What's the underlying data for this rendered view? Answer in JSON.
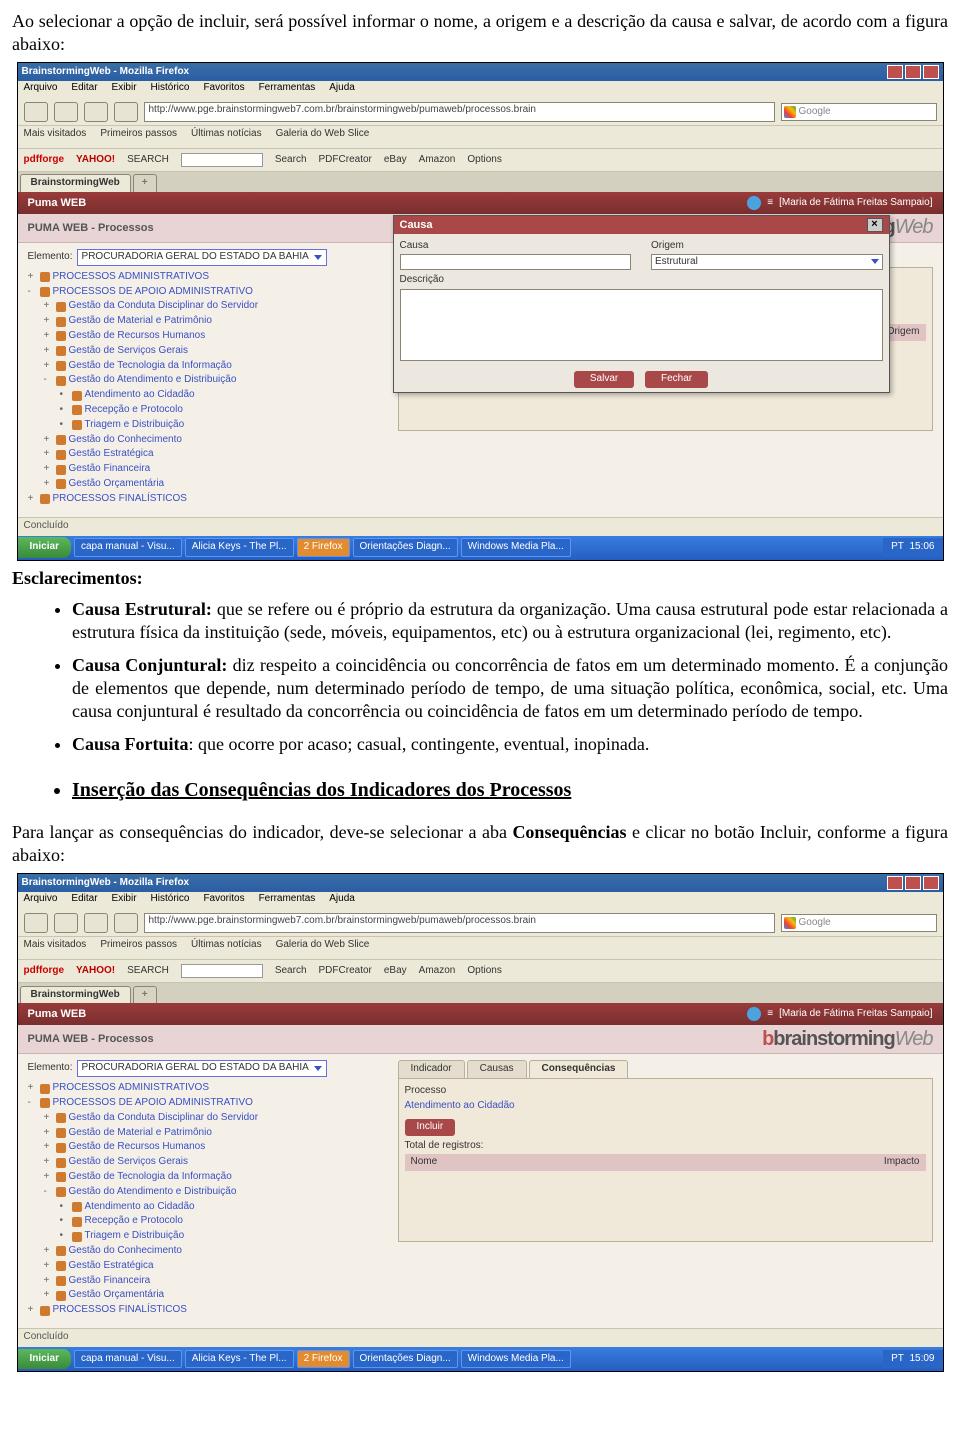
{
  "intro1": "Ao selecionar a opção de incluir, será possível informar o nome, a origem e a descrição da causa e salvar, de acordo com a figura abaixo:",
  "esclarecimentos": "Esclarecimentos:",
  "bullets": {
    "estrutural_label": "Causa Estrutural:",
    "estrutural_text": " que se refere ou é próprio da estrutura da organização. Uma causa estrutural pode estar relacionada a estrutura física da instituição (sede, móveis, equipamentos, etc) ou à estrutura organizacional (lei, regimento, etc).",
    "conjuntural_label": "Causa Conjuntural:",
    "conjuntural_text": " diz respeito a coincidência ou concorrência de fatos em um determinado momento. É a conjunção de elementos que depende, num determinado período de tempo, de uma situação política, econômica, social, etc. Uma causa conjuntural é resultado da concorrência ou coincidência de fatos em um determinado período de tempo.",
    "fortuita_label": "Causa Fortuita",
    "fortuita_text": ": que ocorre por acaso; casual, contingente, eventual, inopinada."
  },
  "section_title": "Inserção das Consequências dos Indicadores dos Processos",
  "intro2a": "Para lançar as consequências do indicador, deve-se  selecionar a aba ",
  "intro2b": "Consequências",
  "intro2c": " e clicar no botão Incluir, conforme a figura abaixo:",
  "browser": {
    "title": "BrainstormingWeb - Mozilla Firefox",
    "menus": [
      "Arquivo",
      "Editar",
      "Exibir",
      "Histórico",
      "Favoritos",
      "Ferramentas",
      "Ajuda"
    ],
    "url": "http://www.pge.brainstormingweb7.com.br/brainstormingweb/pumaweb/processos.brain",
    "search_hint": "Google",
    "bookmarks": [
      "Mais visitados",
      "Primeiros passos",
      "Últimas notícias",
      "Galeria do Web Slice"
    ],
    "pdfbar": {
      "pdfforge": "pdfforge",
      "yahoo": "YAHOO!",
      "search_lbl": "SEARCH",
      "search_btn": "Search",
      "pdfc": "PDFCreator",
      "ebay": "eBay",
      "amazon": "Amazon",
      "options": "Options"
    },
    "tab": "BrainstormingWeb",
    "status": "Concluído"
  },
  "app": {
    "title": "Puma WEB",
    "user": "[Maria de Fátima Freitas Sampaio]",
    "subtitle": "PUMA WEB - Processos",
    "brand_b": "b",
    "brand_bs": "brainstorming",
    "brand_web": "Web",
    "elemento_label": "Elemento:",
    "elemento_value": "PROCURADORIA GERAL DO ESTADO DA BAHIA",
    "tree": [
      {
        "lvl": 1,
        "exp": "+",
        "txt": "PROCESSOS ADMINISTRATIVOS"
      },
      {
        "lvl": 1,
        "exp": "-",
        "txt": "PROCESSOS DE APOIO ADMINISTRATIVO"
      },
      {
        "lvl": 2,
        "exp": "+",
        "txt": "Gestão da Conduta Disciplinar do Servidor"
      },
      {
        "lvl": 2,
        "exp": "+",
        "txt": "Gestão de Material e Patrimônio"
      },
      {
        "lvl": 2,
        "exp": "+",
        "txt": "Gestão de Recursos Humanos"
      },
      {
        "lvl": 2,
        "exp": "+",
        "txt": "Gestão de Serviços Gerais"
      },
      {
        "lvl": 2,
        "exp": "+",
        "txt": "Gestão de Tecnologia da Informação"
      },
      {
        "lvl": 2,
        "exp": "-",
        "txt": "Gestão do Atendimento e Distribuição"
      },
      {
        "lvl": 3,
        "exp": "•",
        "txt": "Atendimento ao Cidadão"
      },
      {
        "lvl": 3,
        "exp": "•",
        "txt": "Recepção e Protocolo"
      },
      {
        "lvl": 3,
        "exp": "•",
        "txt": "Triagem e Distribuição"
      },
      {
        "lvl": 2,
        "exp": "+",
        "txt": "Gestão do Conhecimento"
      },
      {
        "lvl": 2,
        "exp": "+",
        "txt": "Gestão Estratégica"
      },
      {
        "lvl": 2,
        "exp": "+",
        "txt": "Gestão Financeira"
      },
      {
        "lvl": 2,
        "exp": "+",
        "txt": "Gestão Orçamentária"
      },
      {
        "lvl": 1,
        "exp": "+",
        "txt": "PROCESSOS FINALÍSTICOS"
      }
    ],
    "tabs": [
      "Indicador",
      "Causas",
      "Consequências"
    ],
    "origem_col": "Origem",
    "nome_col": "Nome",
    "impacto_col": "Impacto",
    "processo_lbl": "Processo",
    "processo_val": "Atendimento ao Cidadão",
    "incluir": "Incluir",
    "total": "Total de registros:"
  },
  "dialog": {
    "title": "Causa",
    "causa_lbl": "Causa",
    "origem_lbl": "Origem",
    "origem_val": "Estrutural",
    "desc_lbl": "Descrição",
    "salvar": "Salvar",
    "fechar": "Fechar"
  },
  "taskbar": {
    "start": "Iniciar",
    "items": [
      "capa manual - Visu...",
      "Alicia Keys - The Pl...",
      "2 Firefox",
      "Orientações Diagn...",
      "Windows Media Pla..."
    ],
    "lang": "PT",
    "time1": "15:06",
    "time2": "15:09"
  }
}
